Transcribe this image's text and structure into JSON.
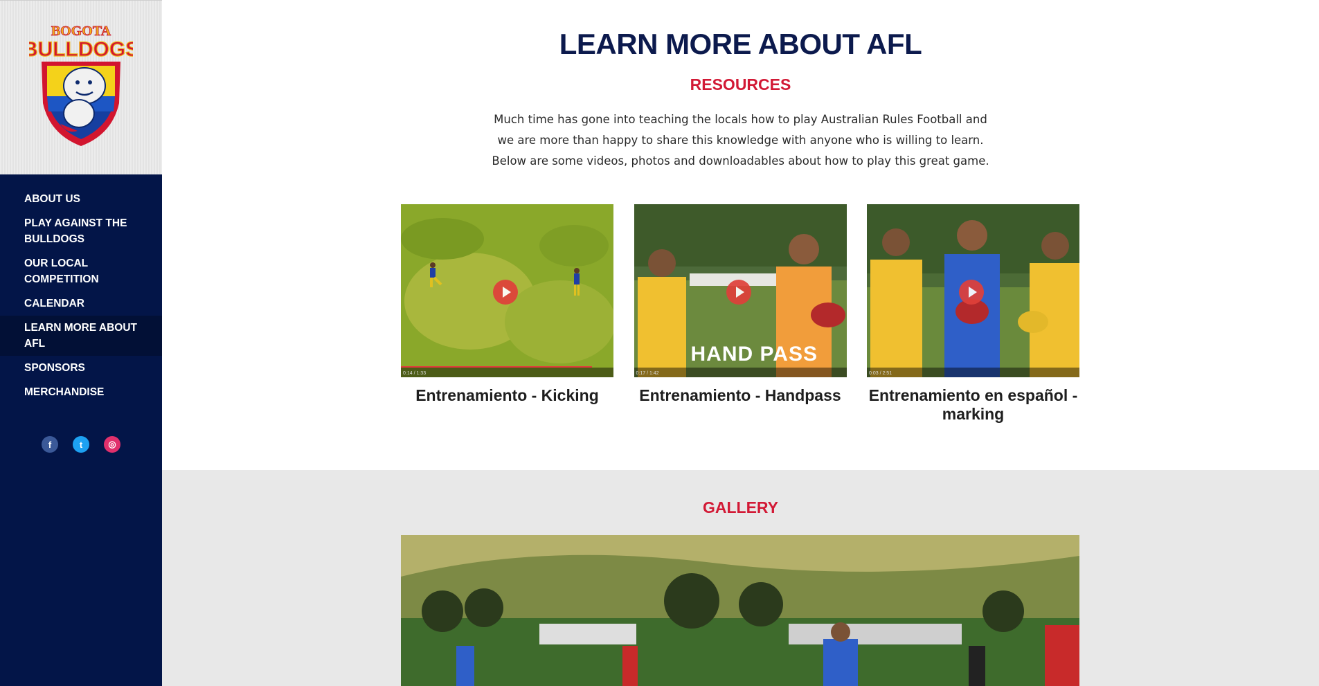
{
  "sidebar": {
    "logo": {
      "line1": "BOGOTA",
      "line2": "BULLDOGS"
    },
    "nav": [
      {
        "label": "ABOUT US"
      },
      {
        "label": "PLAY AGAINST THE BULLDOGS"
      },
      {
        "label": "OUR LOCAL COMPETITION"
      },
      {
        "label": "CALENDAR"
      },
      {
        "label": "LEARN MORE ABOUT AFL",
        "active": true
      },
      {
        "label": "SPONSORS"
      },
      {
        "label": "MERCHANDISE"
      }
    ],
    "social": [
      {
        "icon": "facebook-icon",
        "glyph": "f"
      },
      {
        "icon": "twitter-icon",
        "glyph": "t"
      },
      {
        "icon": "instagram-icon",
        "glyph": "◎"
      }
    ]
  },
  "main": {
    "title": "LEARN MORE ABOUT AFL",
    "resources_heading": "RESOURCES",
    "intro": "Much time has gone into teaching the locals how to play Australian Rules Football and we are more than happy to share this knowledge with anyone who is willing to learn. Below are some videos, photos and downloadables about how to play this great game.",
    "videos": [
      {
        "title": "Entrenamiento - Kicking",
        "time": "0:14 / 1:33",
        "progress": 0.9,
        "overlay_text": ""
      },
      {
        "title": "Entrenamiento - Handpass",
        "time": "0:17 / 1:42",
        "progress": 0.0,
        "overlay_text": "HAND PASS"
      },
      {
        "title": "Entrenamiento en español - marking",
        "time": "0:03 / 2:51",
        "progress": 0.0,
        "overlay_text": ""
      }
    ],
    "gallery_heading": "GALLERY"
  },
  "colors": {
    "navy": "#031548",
    "title_navy": "#0c1a4d",
    "accent_red": "#d21935"
  }
}
